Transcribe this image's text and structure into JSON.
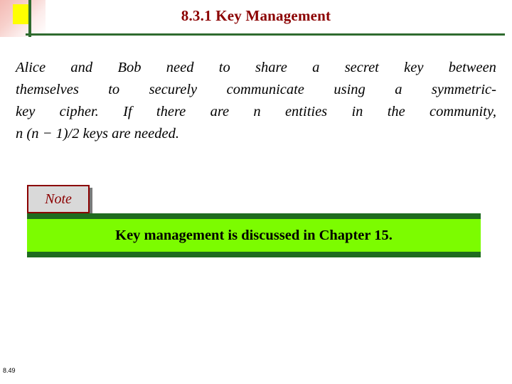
{
  "slide": {
    "title": "8.3.1  Key Management",
    "footer": "8.49",
    "body_lines": [
      "Alice and Bob need to share a secret key between",
      "themselves to securely communicate using a symmetric-",
      "key cipher. If there are n entities in the community,",
      "n (n − 1)/2 keys are needed."
    ],
    "body_words": [
      [
        "Alice",
        "and",
        "Bob",
        "need",
        "to",
        "share",
        "a",
        "secret",
        "key",
        "between"
      ],
      [
        "themselves",
        "to",
        "securely",
        "communicate",
        "using",
        "a",
        "symmetric-"
      ],
      [
        "key",
        "cipher.",
        "If",
        "there",
        "are",
        "n",
        "entities",
        "in",
        "the",
        "community,"
      ],
      [
        "n (n − 1)/2 keys are needed."
      ]
    ],
    "note": {
      "tab_label": "Note",
      "text": "Key management is discussed in Chapter 15."
    },
    "colors": {
      "title": "#8b0000",
      "rule": "#2f6b2f",
      "note_border": "#8b0000",
      "note_bar": "#1f6b1f",
      "note_fill": "#7cfc00",
      "accent_yellow": "#ffff00"
    }
  }
}
